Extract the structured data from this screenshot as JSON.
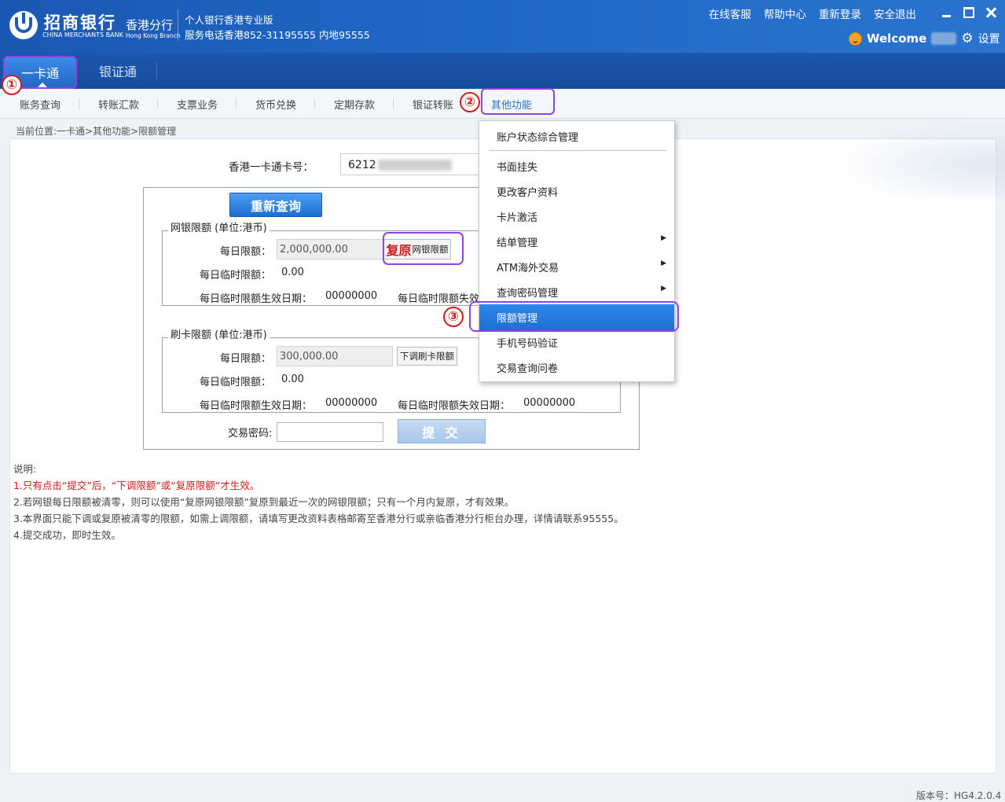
{
  "header": {
    "brand_cn": "招商银行",
    "brand_en": "CHINA MERCHANTS BANK",
    "branch_cn": "香港分行",
    "branch_en": "Hong Kong Branch",
    "slogan_line1": "个人银行香港专业版",
    "slogan_line2": "服务电话香港852-31195555 内地95555",
    "links": [
      "在线客服",
      "帮助中心",
      "重新登录",
      "安全退出"
    ],
    "welcome": "Welcome",
    "settings": "设置"
  },
  "nav": {
    "tabs": [
      {
        "label": "一卡通"
      },
      {
        "label": "银证通"
      }
    ]
  },
  "subnav": {
    "items": [
      "账务查询",
      "转账汇款",
      "支票业务",
      "货币兑换",
      "定期存款",
      "银证转账",
      "其他功能"
    ]
  },
  "breadcrumb": "当前位置:一卡通>其他功能>限额管理",
  "form": {
    "card_label": "香港一卡通卡号：",
    "card_value": "6212",
    "requery_button": "重新查询",
    "netbank": {
      "legend": "网银限额 (单位:港币)",
      "daily_label": "每日限额：",
      "daily_value": "2,000,000.00",
      "restore_big": "复原",
      "restore_small": "网银限额",
      "temp_label": "每日临时限额：",
      "temp_value": "0.00",
      "start_label": "每日临时限额生效日期：",
      "start_value": "00000000",
      "end_label": "每日临时限额失效"
    },
    "card": {
      "legend": "刷卡限额 (单位:港币)",
      "daily_label": "每日限额：",
      "daily_value": "300,000.00",
      "lower_button": "下调刷卡限额",
      "temp_label": "每日临时限额：",
      "temp_value": "0.00",
      "start_label": "每日临时限额生效日期：",
      "start_value": "00000000",
      "end_label": "每日临时限额失效日期：",
      "end_value": "00000000"
    },
    "pwd_label": "交易密码:",
    "submit_button": "提 交"
  },
  "notes": {
    "title": "说明:",
    "line1": "1.只有点击“提交”后，“下调限额”或“复原限额”才生效。",
    "line2": "2.若网银每日限额被清零，则可以使用“复原网银限额”复原到最近一次的网银限额；只有一个月内复原，才有效果。",
    "line3": "3.本界面只能下调或复原被清零的限额，如需上调限额，请填写更改资料表格邮寄至香港分行或亲临香港分行柜台办理，详情请联系95555。",
    "line4": "4.提交成功，即时生效。"
  },
  "dropdown": {
    "items": [
      "账户状态综合管理",
      "书面挂失",
      "更改客户资料",
      "卡片激活",
      "结单管理",
      "ATM海外交易",
      "查询密码管理",
      "限额管理",
      "手机号码验证",
      "交易查询问卷"
    ],
    "selected": "限额管理"
  },
  "annotations": [
    "①",
    "②",
    "③"
  ],
  "version": "版本号：HG4.2.0.4",
  "colors": {
    "accent": "#1f66c4",
    "highlight": "#8e44e0",
    "badge": "#d41d1d",
    "warning_text": "#d0191b"
  }
}
